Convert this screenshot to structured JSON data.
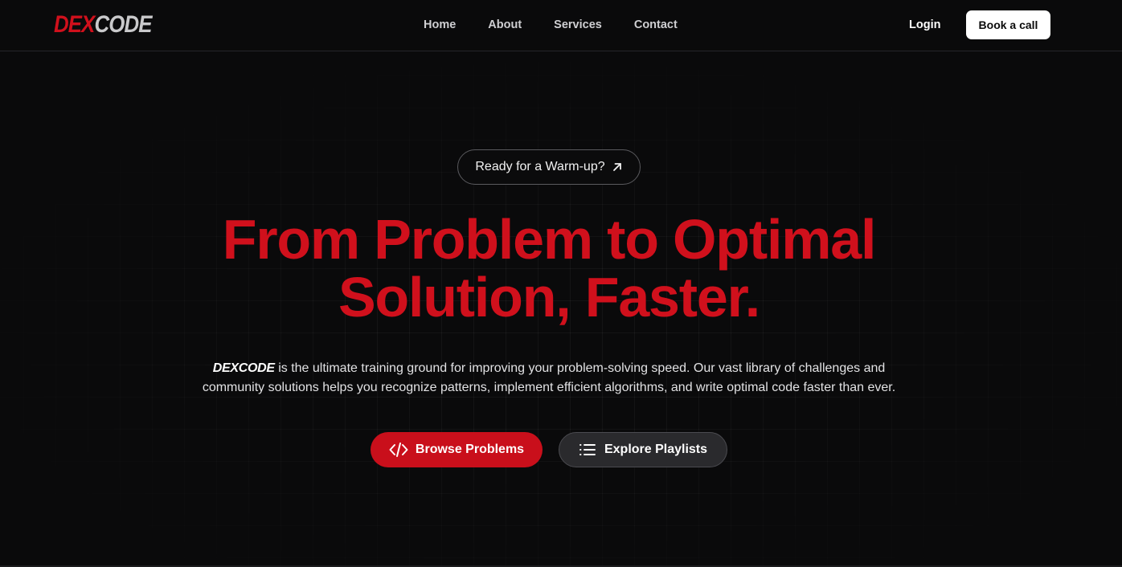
{
  "nav": {
    "logo": {
      "part1": "DEX",
      "part2": "CODE"
    },
    "links": [
      "Home",
      "About",
      "Services",
      "Contact"
    ],
    "login": "Login",
    "cta": "Book a call"
  },
  "hero": {
    "badge": {
      "label": "Ready for a Warm-up?",
      "icon": "arrow-up-right-icon"
    },
    "headline": {
      "line1": "From Problem to Optimal",
      "line2": "Solution, Faster."
    },
    "description": {
      "brand": "DEXCODE",
      "text": " is the ultimate training ground for improving your problem-solving speed. Our vast library of challenges and community solutions helps you recognize patterns, implement efficient algorithms, and write optimal code faster than ever."
    },
    "primary_button": {
      "label": "Browse Problems",
      "icon": "code-icon"
    },
    "secondary_button": {
      "label": "Explore Playlists",
      "icon": "list-icon"
    }
  },
  "colors": {
    "accent": "#d0101c",
    "background": "#0a0a0b",
    "secondary_button": "#2a2a2d"
  }
}
